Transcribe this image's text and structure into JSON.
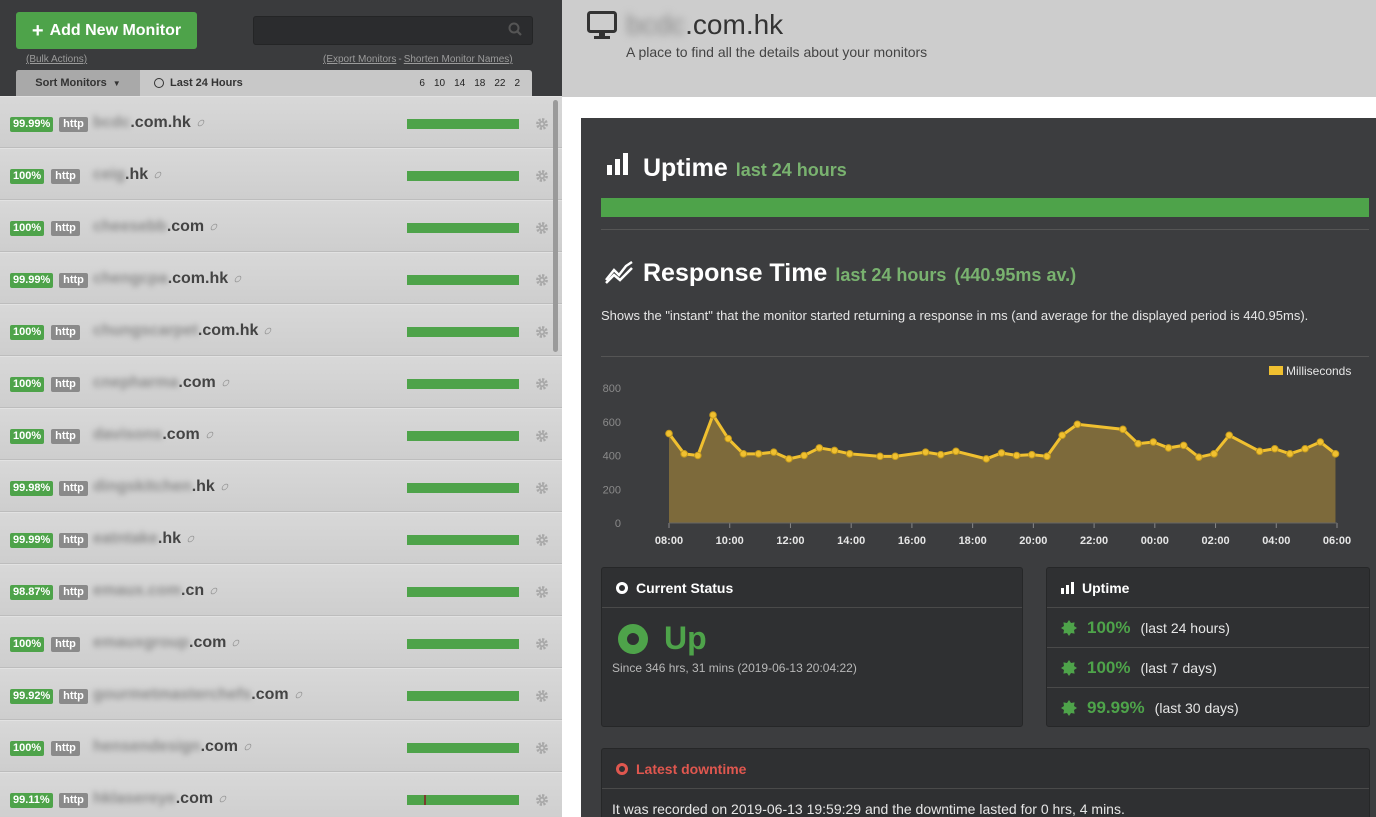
{
  "sidebar": {
    "add_button_label": "Add New Monitor",
    "bulk_actions": "(Bulk Actions)",
    "export_monitors": "(Export Monitors",
    "shorten_names": "Shorten Monitor Names)",
    "sort_label": "Sort Monitors",
    "range_label": "Last 24 Hours",
    "hour_ticks": [
      "6",
      "10",
      "14",
      "18",
      "22",
      "2"
    ]
  },
  "monitors": [
    {
      "uptime": "99.99%",
      "protocol": "http",
      "name_hidden": "bcdc",
      "name_visible": ".com.hk"
    },
    {
      "uptime": "100%",
      "protocol": "http",
      "name_hidden": "ceig",
      "name_visible": ".hk"
    },
    {
      "uptime": "100%",
      "protocol": "http",
      "name_hidden": "cheesebb",
      "name_visible": ".com"
    },
    {
      "uptime": "99.99%",
      "protocol": "http",
      "name_hidden": "chengcpa",
      "name_visible": ".com.hk"
    },
    {
      "uptime": "100%",
      "protocol": "http",
      "name_hidden": "chungscarpet",
      "name_visible": ".com.hk"
    },
    {
      "uptime": "100%",
      "protocol": "http",
      "name_hidden": "cnepharma",
      "name_visible": ".com"
    },
    {
      "uptime": "100%",
      "protocol": "http",
      "name_hidden": "davisons",
      "name_visible": ".com"
    },
    {
      "uptime": "99.98%",
      "protocol": "http",
      "name_hidden": "dingskitchen",
      "name_visible": ".hk"
    },
    {
      "uptime": "99.99%",
      "protocol": "http",
      "name_hidden": "eatntake",
      "name_visible": ".hk"
    },
    {
      "uptime": "98.87%",
      "protocol": "http",
      "name_hidden": "emaux.com",
      "name_visible": ".cn"
    },
    {
      "uptime": "100%",
      "protocol": "http",
      "name_hidden": "emauxgroup",
      "name_visible": ".com"
    },
    {
      "uptime": "99.92%",
      "protocol": "http",
      "name_hidden": "gourmetmasterchefs",
      "name_visible": ".com"
    },
    {
      "uptime": "100%",
      "protocol": "http",
      "name_hidden": "hensendesign",
      "name_visible": ".com"
    },
    {
      "uptime": "99.11%",
      "protocol": "http",
      "name_hidden": "hklasereye",
      "name_visible": ".com"
    }
  ],
  "header": {
    "title_hidden": "bcdc",
    "title_visible": ".com.hk",
    "subtitle": "A place to find all the details about your monitors"
  },
  "uptime_section": {
    "title": "Uptime",
    "range": "last 24 hours"
  },
  "response_section": {
    "title": "Response Time",
    "range": "last 24 hours",
    "average": "(440.95ms av.)",
    "description": "Shows the \"instant\" that the monitor started returning a response in ms (and average for the displayed period is 440.95ms)."
  },
  "chart_data": {
    "type": "area",
    "series": [
      {
        "name": "Milliseconds",
        "color": "#f0c030"
      }
    ],
    "x_ticks": [
      "08:00",
      "10:00",
      "12:00",
      "14:00",
      "16:00",
      "18:00",
      "20:00",
      "22:00",
      "00:00",
      "02:00",
      "04:00",
      "06:00"
    ],
    "y_ticks": [
      "0",
      "200",
      "400",
      "600",
      "800"
    ],
    "ylim": [
      0,
      800
    ],
    "xlim": [
      8.0,
      30.0
    ],
    "points": [
      [
        8.0,
        530
      ],
      [
        8.5,
        410
      ],
      [
        8.95,
        400
      ],
      [
        9.45,
        640
      ],
      [
        9.95,
        500
      ],
      [
        10.45,
        410
      ],
      [
        10.95,
        410
      ],
      [
        11.45,
        420
      ],
      [
        11.95,
        380
      ],
      [
        12.45,
        400
      ],
      [
        12.95,
        445
      ],
      [
        13.45,
        430
      ],
      [
        13.95,
        410
      ],
      [
        14.95,
        395
      ],
      [
        15.45,
        395
      ],
      [
        16.45,
        420
      ],
      [
        16.95,
        405
      ],
      [
        17.45,
        425
      ],
      [
        18.45,
        380
      ],
      [
        18.95,
        415
      ],
      [
        19.45,
        400
      ],
      [
        19.95,
        405
      ],
      [
        20.45,
        395
      ],
      [
        20.95,
        520
      ],
      [
        21.45,
        585
      ],
      [
        22.95,
        555
      ],
      [
        23.45,
        470
      ],
      [
        23.95,
        480
      ],
      [
        24.45,
        445
      ],
      [
        24.95,
        460
      ],
      [
        25.45,
        390
      ],
      [
        25.95,
        410
      ],
      [
        26.45,
        520
      ],
      [
        27.45,
        425
      ],
      [
        27.95,
        440
      ],
      [
        28.45,
        410
      ],
      [
        28.95,
        440
      ],
      [
        29.45,
        480
      ],
      [
        29.95,
        410
      ]
    ]
  },
  "status_card": {
    "title": "Current Status",
    "status": "Up",
    "since": "Since 346 hrs, 31 mins (2019-06-13 20:04:22)"
  },
  "uptime_card": {
    "title": "Uptime",
    "rows": [
      {
        "value": "100%",
        "label": "(last 24 hours)"
      },
      {
        "value": "100%",
        "label": "(last 7 days)"
      },
      {
        "value": "99.99%",
        "label": "(last 30 days)"
      }
    ]
  },
  "downtime_card": {
    "title": "Latest downtime",
    "text": "It was recorded on 2019-06-13 19:59:29 and the downtime lasted for 0 hrs, 4 mins."
  },
  "colors": {
    "accent_green": "#4ea34a",
    "chart_line": "#f0c030",
    "chart_fill": "#7d6a3b",
    "alert_red": "#e0574f"
  }
}
